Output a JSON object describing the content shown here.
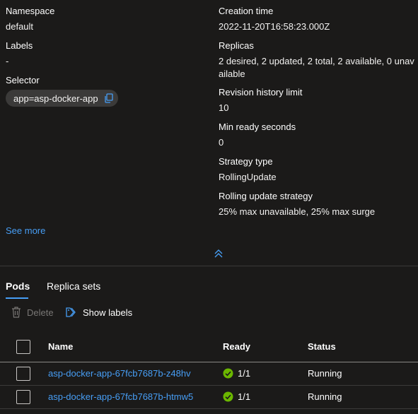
{
  "details": {
    "namespace": {
      "label": "Namespace",
      "value": "default"
    },
    "labels": {
      "label": "Labels",
      "value": "-"
    },
    "selector": {
      "label": "Selector",
      "value": "app=asp-docker-app"
    },
    "creation_time": {
      "label": "Creation time",
      "value": "2022-11-20T16:58:23.000Z"
    },
    "replicas": {
      "label": "Replicas",
      "value": "2 desired, 2 updated, 2 total, 2 available, 0 unav ailable"
    },
    "revision_history_limit": {
      "label": "Revision history limit",
      "value": "10"
    },
    "min_ready_seconds": {
      "label": "Min ready seconds",
      "value": "0"
    },
    "strategy_type": {
      "label": "Strategy type",
      "value": "RollingUpdate"
    },
    "rolling_update_strategy": {
      "label": "Rolling update strategy",
      "value": "25% max unavailable, 25% max surge"
    },
    "see_more": "See more"
  },
  "tabs": [
    {
      "label": "Pods",
      "active": true
    },
    {
      "label": "Replica sets",
      "active": false
    }
  ],
  "toolbar": {
    "delete_label": "Delete",
    "show_labels_label": "Show labels"
  },
  "table": {
    "columns": [
      "Name",
      "Ready",
      "Status"
    ],
    "rows": [
      {
        "name": "asp-docker-app-67fcb7687b-z48hv",
        "ready": "1/1",
        "status": "Running"
      },
      {
        "name": "asp-docker-app-67fcb7687b-htmw5",
        "ready": "1/1",
        "status": "Running"
      }
    ]
  },
  "colors": {
    "background": "#1b1a19",
    "link": "#479ef5",
    "success": "#6bb700",
    "disabled": "#797775"
  },
  "icons": [
    "copy-icon",
    "chevron-double-up-icon",
    "trash-icon",
    "tag-icon",
    "check-circle-icon"
  ]
}
